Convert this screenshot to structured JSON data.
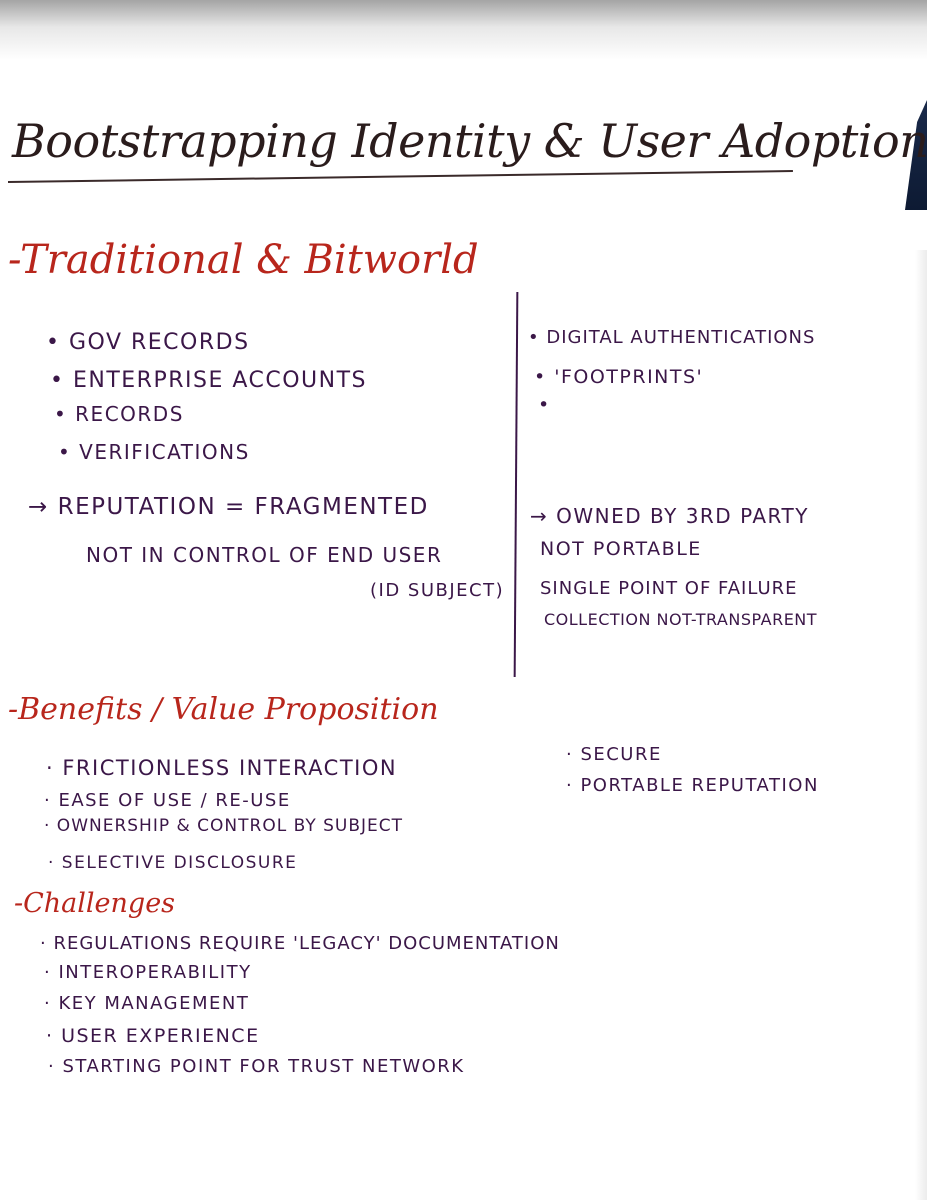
{
  "title": "Bootstrapping Identity & User Adoption",
  "section1": {
    "heading": "-Traditional & Bitworld",
    "left_items": [
      "• GOV RECORDS",
      "• ENTERPRISE ACCOUNTS",
      "• RECORDS",
      "• VERIFICATIONS"
    ],
    "left_notes": [
      "→ REPUTATION = FRAGMENTED",
      "NOT IN CONTROL OF END USER",
      "(ID SUBJECT)"
    ],
    "right_items": [
      "• DIGITAL AUTHENTICATIONS",
      "• 'FOOTPRINTS'",
      "•"
    ],
    "right_notes": [
      "→ OWNED BY 3RD PARTY",
      "NOT PORTABLE",
      "SINGLE POINT OF FAILURE",
      "COLLECTION NOT-TRANSPARENT"
    ]
  },
  "section2": {
    "heading": "-Benefits / Value Proposition",
    "left_items": [
      "· FRICTIONLESS INTERACTION",
      "· EASE OF USE / RE-USE",
      "· OWNERSHIP & CONTROL BY SUBJECT",
      "· SELECTIVE DISCLOSURE"
    ],
    "right_items": [
      "· SECURE",
      "· PORTABLE REPUTATION"
    ]
  },
  "section3": {
    "heading": "-Challenges",
    "items": [
      "· REGULATIONS REQUIRE 'LEGACY' DOCUMENTATION",
      "· INTEROPERABILITY",
      "· KEY MANAGEMENT",
      "· USER EXPERIENCE",
      "· STARTING POINT FOR TRUST NETWORK"
    ]
  }
}
